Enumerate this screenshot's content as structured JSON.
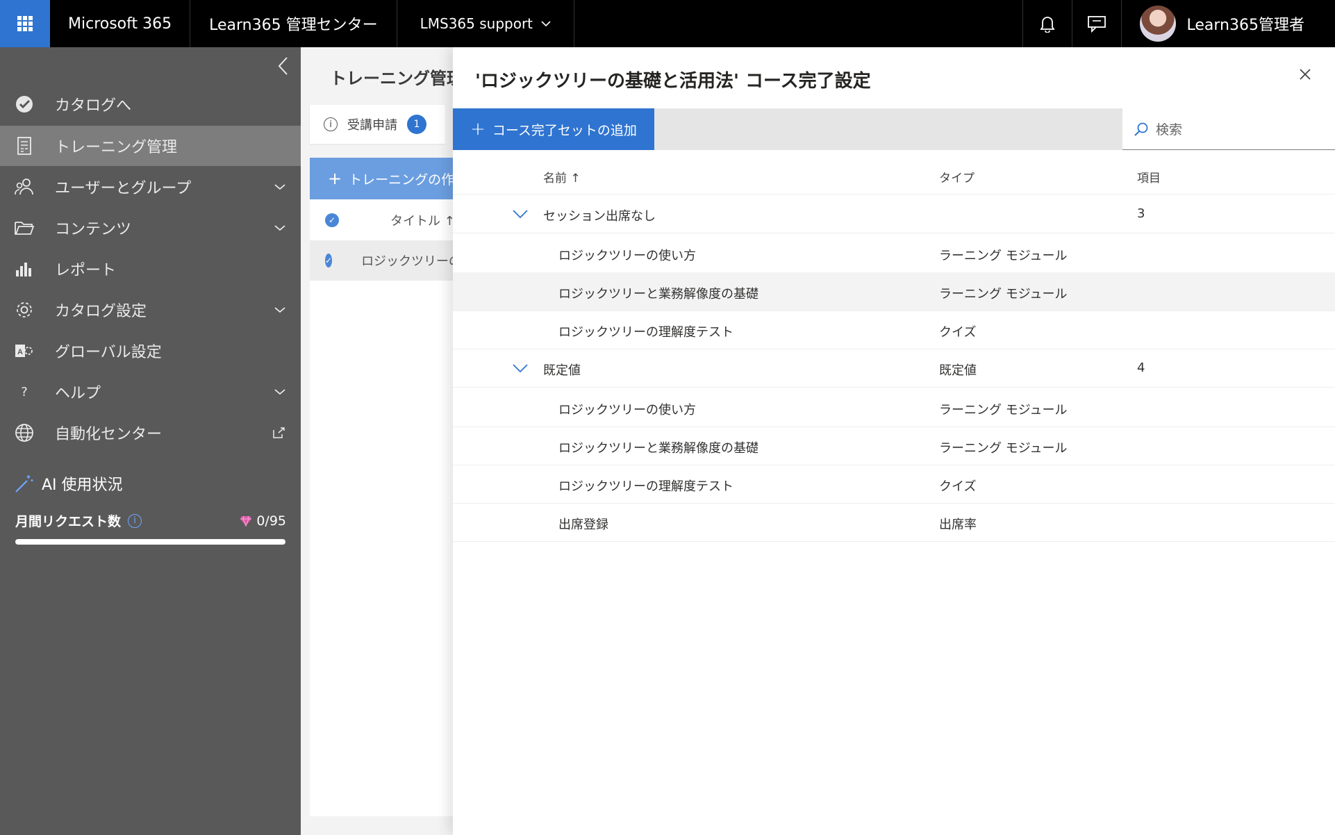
{
  "topbar": {
    "app_launcher_icon": "waffle-icon",
    "brand": "Microsoft 365",
    "center": "Learn365 管理センター",
    "tenant": "LMS365 support",
    "user": "Learn365管理者"
  },
  "nav": {
    "items": [
      {
        "label": "カタログへ",
        "icon": "catalog-check-icon"
      },
      {
        "label": "トレーニング管理",
        "icon": "training-doc-icon"
      },
      {
        "label": "ユーザーとグループ",
        "icon": "users-icon"
      },
      {
        "label": "コンテンツ",
        "icon": "folder-icon"
      },
      {
        "label": "レポート",
        "icon": "chart-icon"
      },
      {
        "label": "カタログ設定",
        "icon": "gear-icon"
      },
      {
        "label": "グローバル設定",
        "icon": "global-settings-icon"
      },
      {
        "label": "ヘルプ",
        "icon": "help-icon"
      },
      {
        "label": "自動化センター",
        "icon": "globe-icon"
      }
    ],
    "ai_title": "AI 使用状況",
    "requests_label": "月間リクエスト数",
    "requests_count": "0/95",
    "requests_used_fraction": 0.0
  },
  "middle": {
    "title": "トレーニング管理",
    "pending_label": "受講申請",
    "pending_count": "1",
    "create_label": "トレーニングの作成",
    "col_title": "タイトル ↑",
    "row_title": "ロジックツリーの基礎と活用法"
  },
  "panel": {
    "title": "'ロジックツリーの基礎と活用法' コース完了設定",
    "add_label": "コース完了セットの追加",
    "search_placeholder": "検索",
    "columns": {
      "name": "名前 ↑",
      "type": "タイプ",
      "items": "項目"
    },
    "groups": [
      {
        "name": "セッション出席なし",
        "type": "",
        "count": "3",
        "rows": [
          {
            "name": "ロジックツリーの使い方",
            "type": "ラーニング モジュール"
          },
          {
            "name": "ロジックツリーと業務解像度の基礎",
            "type": "ラーニング モジュール"
          },
          {
            "name": "ロジックツリーの理解度テスト",
            "type": "クイズ"
          }
        ]
      },
      {
        "name": "既定値",
        "type": "既定値",
        "count": "4",
        "rows": [
          {
            "name": "ロジックツリーの使い方",
            "type": "ラーニング モジュール"
          },
          {
            "name": "ロジックツリーと業務解像度の基礎",
            "type": "ラーニング モジュール"
          },
          {
            "name": "ロジックツリーの理解度テスト",
            "type": "クイズ"
          },
          {
            "name": "出席登録",
            "type": "出席率"
          }
        ]
      }
    ]
  },
  "colors": {
    "accent": "#2f74d0",
    "nav_bg": "#595959",
    "topbar": "#000000"
  }
}
